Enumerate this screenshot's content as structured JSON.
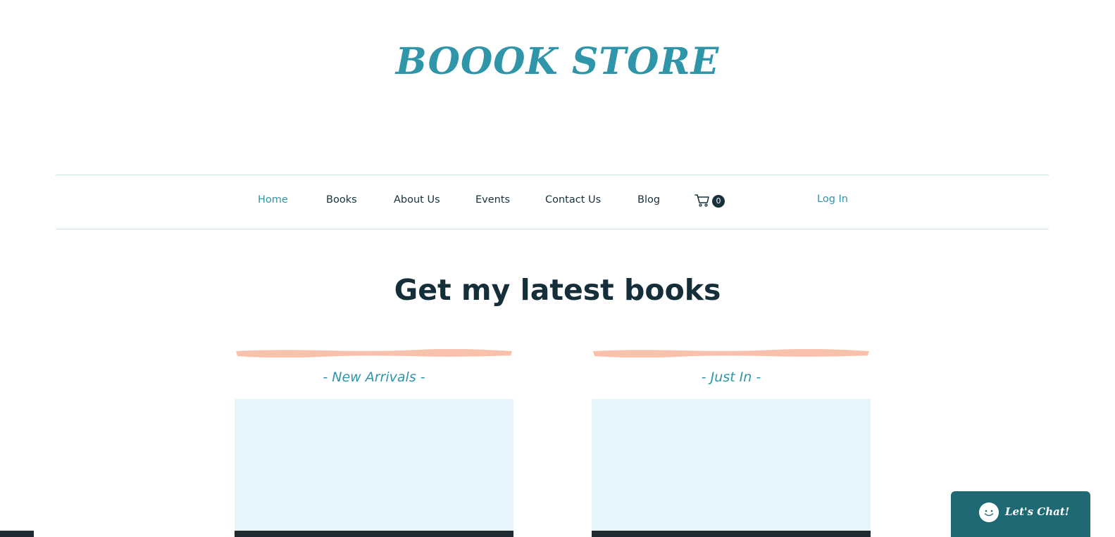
{
  "site": {
    "logo_text": "BOOOK STORE"
  },
  "nav": {
    "items": [
      {
        "label": "Home",
        "active": true
      },
      {
        "label": "Books"
      },
      {
        "label": "About Us"
      },
      {
        "label": "Events"
      },
      {
        "label": "Contact Us"
      },
      {
        "label": "Blog"
      }
    ],
    "cart_count": "0",
    "login_label": "Log In"
  },
  "main": {
    "heading": "Get my latest books",
    "columns": [
      {
        "title": "- New Arrivals -"
      },
      {
        "title": "- Just In -"
      }
    ]
  },
  "chat": {
    "label": "Let's Chat!"
  },
  "colors": {
    "accent": "#2f95a8",
    "dark_text": "#142f3a",
    "brush": "#f7c1ac",
    "book_placeholder": "#e6f4fc",
    "chat_bg": "#1f6975"
  }
}
